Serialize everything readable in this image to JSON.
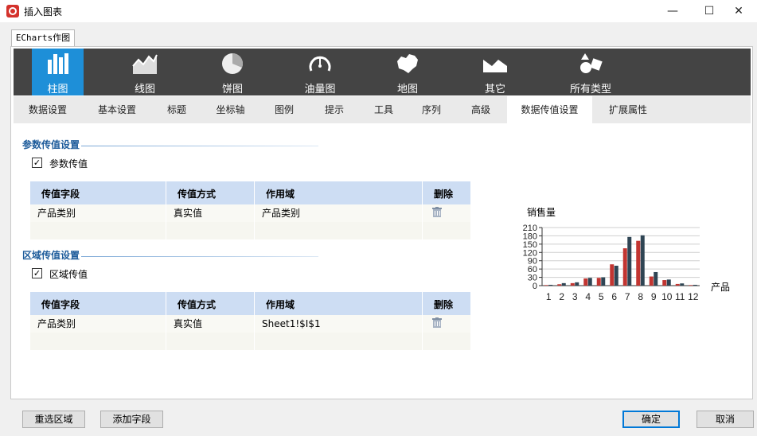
{
  "window": {
    "title": "插入图表",
    "minimize": "—",
    "maximize": "☐",
    "close": "✕"
  },
  "doc_tab": "ECharts作图",
  "chart_types": [
    {
      "label": "柱图",
      "icon": "bar-chart-icon",
      "active": true
    },
    {
      "label": "线图",
      "icon": "line-chart-icon",
      "active": false
    },
    {
      "label": "饼图",
      "icon": "pie-chart-icon",
      "active": false
    },
    {
      "label": "油量图",
      "icon": "gauge-icon",
      "active": false
    },
    {
      "label": "地图",
      "icon": "map-icon",
      "active": false
    },
    {
      "label": "其它",
      "icon": "area-icon",
      "active": false
    },
    {
      "label": "所有类型",
      "icon": "shapes-icon",
      "active": false
    }
  ],
  "settings_tabs": [
    {
      "label": "数据设置",
      "active": false
    },
    {
      "label": "基本设置",
      "active": false
    },
    {
      "label": "标题",
      "active": false
    },
    {
      "label": "坐标轴",
      "active": false
    },
    {
      "label": "图例",
      "active": false
    },
    {
      "label": "提示",
      "active": false
    },
    {
      "label": "工具",
      "active": false
    },
    {
      "label": "序列",
      "active": false
    },
    {
      "label": "高级",
      "active": false
    },
    {
      "label": "数据传值设置",
      "active": true
    },
    {
      "label": "扩展属性",
      "active": false
    }
  ],
  "param_section": {
    "title": "参数传值设置",
    "checkbox_label": "参数传值",
    "checked": true,
    "columns": [
      "传值字段",
      "传值方式",
      "作用域",
      "删除"
    ],
    "rows": [
      {
        "field": "产品类别",
        "method": "真实值",
        "scope": "产品类别"
      }
    ]
  },
  "area_section": {
    "title": "区域传值设置",
    "checkbox_label": "区域传值",
    "checked": true,
    "columns": [
      "传值字段",
      "传值方式",
      "作用域",
      "删除"
    ],
    "rows": [
      {
        "field": "产品类别",
        "method": "真实值",
        "scope": "Sheet1!$I$1"
      }
    ]
  },
  "buttons": {
    "reselect": "重选区域",
    "add_field": "添加字段",
    "ok": "确定",
    "cancel": "取消"
  },
  "chart_data": {
    "type": "bar",
    "ylabel": "销售量",
    "xlabel": "产品",
    "ylim": [
      0,
      210
    ],
    "yticks": [
      0,
      30,
      60,
      90,
      120,
      150,
      180,
      210
    ],
    "categories": [
      "1",
      "2",
      "3",
      "4",
      "5",
      "6",
      "7",
      "8",
      "9",
      "10",
      "11",
      "12"
    ],
    "series_colors": [
      "#c23531",
      "#2f4554"
    ],
    "series": [
      {
        "values": [
          2,
          5,
          9,
          26,
          28,
          77,
          135,
          162,
          33,
          20,
          6,
          2
        ]
      },
      {
        "values": [
          3,
          9,
          12,
          28,
          30,
          72,
          176,
          182,
          49,
          22,
          8,
          3
        ]
      }
    ]
  }
}
